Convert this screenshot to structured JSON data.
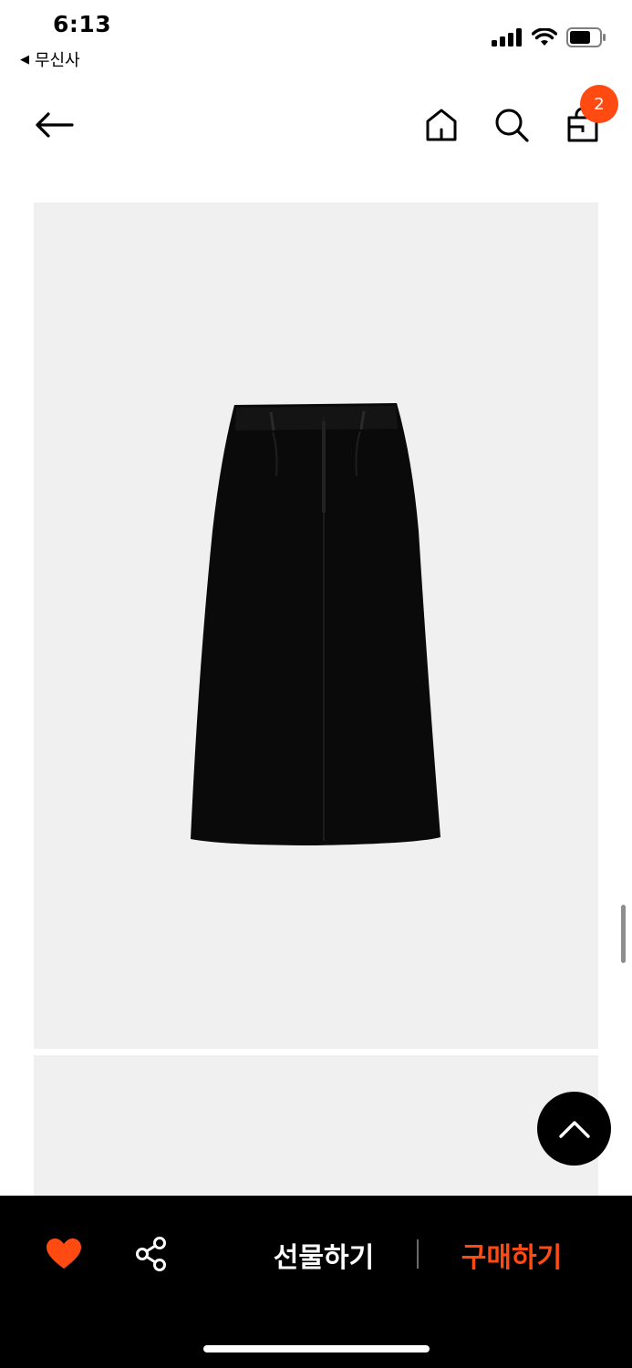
{
  "status_bar": {
    "time": "6:13",
    "back_app_label": "무신사",
    "signal_icon": "signal-bars-icon",
    "wifi_icon": "wifi-icon",
    "battery_icon": "battery-icon"
  },
  "nav": {
    "back_icon": "arrow-left-icon",
    "home_icon": "home-icon",
    "search_icon": "search-icon",
    "cart_icon": "shopping-bag-icon",
    "cart_count": "2"
  },
  "product": {
    "image_alt_icon": "black-midi-skirt-image"
  },
  "bottom_bar": {
    "like_icon": "heart-icon",
    "share_icon": "share-icon",
    "gift_label": "선물하기",
    "buy_label": "구매하기"
  },
  "colors": {
    "accent": "#ff4a12",
    "bottom_bar_bg": "#000000",
    "image_bg": "#f0f0f0"
  }
}
